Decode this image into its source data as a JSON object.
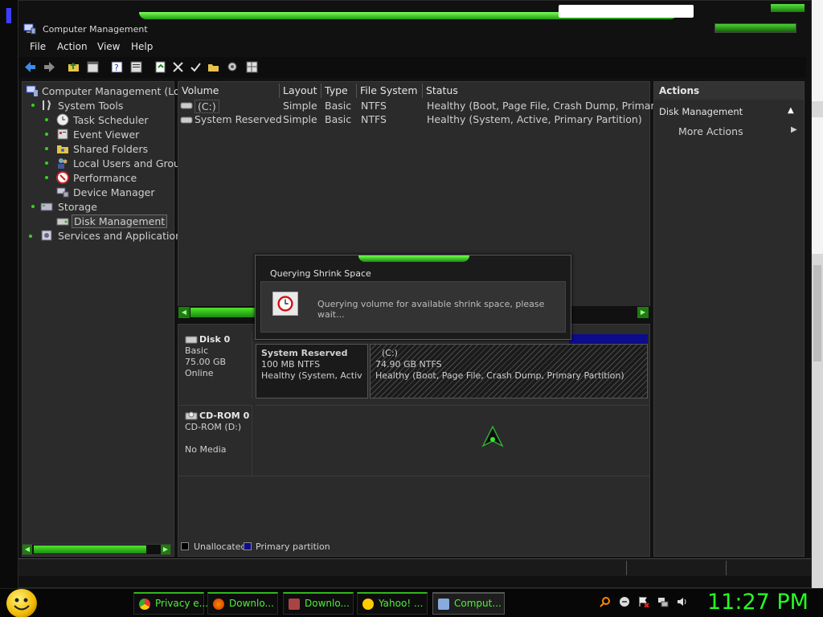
{
  "window": {
    "title": "Computer Management",
    "menu": [
      "File",
      "Action",
      "View",
      "Help"
    ]
  },
  "tree": {
    "root": "Computer Management (Loc",
    "system_tools": "System Tools",
    "task_scheduler": "Task Scheduler",
    "event_viewer": "Event Viewer",
    "shared_folders": "Shared Folders",
    "local_users": "Local Users and Grou",
    "performance": "Performance",
    "device_manager": "Device Manager",
    "storage": "Storage",
    "disk_management": "Disk Management",
    "services": "Services and Application"
  },
  "volumes": {
    "headers": [
      "Volume",
      "Layout",
      "Type",
      "File System",
      "Status"
    ],
    "rows": [
      [
        "(C:)",
        "Simple",
        "Basic",
        "NTFS",
        "Healthy (Boot, Page File, Crash Dump, Primary"
      ],
      [
        "System Reserved",
        "Simple",
        "Basic",
        "NTFS",
        "Healthy (System, Active, Primary Partition)"
      ]
    ]
  },
  "disks": {
    "disk0": {
      "name": "Disk 0",
      "type": "Basic",
      "size": "75.00 GB",
      "state": "Online"
    },
    "cdrom0": {
      "name": "CD-ROM 0",
      "drive": "CD-ROM (D:)",
      "media": "No Media"
    },
    "sysres": {
      "name": "System Reserved",
      "size": "100 MB NTFS",
      "status": "Healthy (System, Active, P"
    },
    "c": {
      "name": "(C:)",
      "size": "74.90 GB NTFS",
      "status": "Healthy (Boot, Page File, Crash Dump, Primary Partition)"
    }
  },
  "legend": {
    "unallocated": "Unallocated",
    "primary": "Primary partition",
    "unallocated_color": "#000000",
    "primary_color": "#0c0c8c"
  },
  "actions": {
    "header": "Actions",
    "section": "Disk Management",
    "more": "More Actions"
  },
  "dialog": {
    "title": "Querying Shrink Space",
    "message": "Querying volume for available shrink space, please wait..."
  },
  "taskbar": {
    "tasks": [
      "Privacy e...",
      "Downlo...",
      "Downlo...",
      "Yahoo! ...",
      "Comput..."
    ],
    "clock": "11:27 PM"
  },
  "colors": {
    "accent": "#39d01f",
    "clock": "#24ff24"
  }
}
